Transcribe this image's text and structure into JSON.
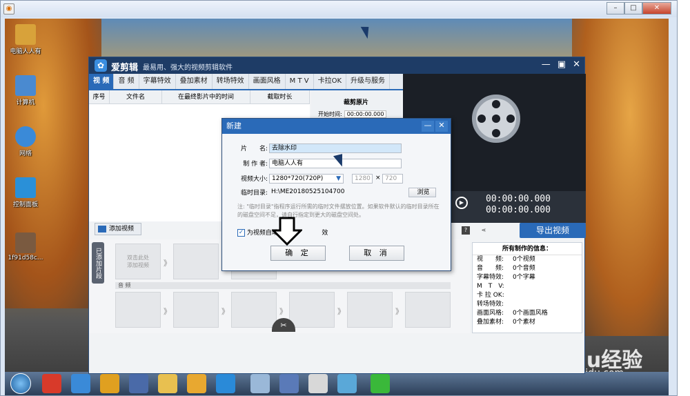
{
  "outer_window": {
    "controls": [
      "–",
      "□",
      "✕"
    ]
  },
  "desktop_icons": [
    {
      "label": "电脑人人有",
      "icon": "folder-icon",
      "color": "#d8a23a"
    },
    {
      "label": "计算机",
      "icon": "computer-icon",
      "color": "#4a8ad0"
    },
    {
      "label": "网络",
      "icon": "network-icon",
      "color": "#3a8ad8"
    },
    {
      "label": "控制面板",
      "icon": "control-panel-icon",
      "color": "#2a90d8"
    },
    {
      "label": "1f91d58c...",
      "icon": "image-file-icon",
      "color": "#7a5a40"
    }
  ],
  "app": {
    "name": "爱剪辑",
    "tagline": "最易用、强大的视频剪辑软件",
    "controls": [
      "—",
      "▣",
      "✕"
    ],
    "tabs": [
      "视 频",
      "音 频",
      "字幕特效",
      "叠加素材",
      "转场特效",
      "画面风格",
      "M T V",
      "卡拉OK",
      "升级与服务"
    ],
    "table_headers": [
      "序号",
      "文件名",
      "在最终影片中的时间",
      "截取时长"
    ],
    "crop": {
      "title": "裁剪原片",
      "start_label": "开始时间:",
      "start_value": "00:00:00.000"
    },
    "time_top": "00:00:00.000",
    "time_bottom": "00:00:00.000",
    "export_label": "导出视频",
    "add_video_label": "添加视频",
    "timeline_label": "已添加片段",
    "first_clip_text": "双击此处\n添加视频",
    "audio_label": "音 频",
    "info": {
      "title": "所有制作的信息：",
      "rows": [
        {
          "k": "视　　频:",
          "v": "0个视频"
        },
        {
          "k": "音　　频:",
          "v": "0个音频"
        },
        {
          "k": "字幕特效:",
          "v": "0个字幕"
        },
        {
          "k": "M　T　V:",
          "v": ""
        },
        {
          "k": "卡 拉 OK:",
          "v": ""
        },
        {
          "k": "转场特效:",
          "v": ""
        },
        {
          "k": "画面风格:",
          "v": "0个画面风格"
        },
        {
          "k": "叠加素材:",
          "v": "0个素材"
        }
      ]
    }
  },
  "dialog": {
    "title": "新建",
    "controls": [
      "—",
      "✕"
    ],
    "fields": {
      "name_label": "片　　名:",
      "name_value": "去除水印",
      "author_label": "制 作 者:",
      "author_value": "电脑人人有",
      "size_label": "视频大小:",
      "size_value": "1280*720(720P)",
      "width_value": "1280",
      "height_value": "720",
      "times": "×",
      "temp_label": "临时目录:",
      "temp_value": "H:\\ME20180525104700",
      "browse_label": "浏览"
    },
    "note": "注: \"临时目录\"指程序运行所需的临时文件摆放位置。如果软件默认的临时目录所在的磁盘空间不足，请自行指定到更大的磁盘空间处。",
    "checkbox_label": "为视频自动...",
    "checkbox_suffix": "效",
    "ok_label": "确 定",
    "cancel_label": "取 消"
  },
  "watermark": {
    "logo": "Baidu经验",
    "url": "jingyan.baidu.com"
  }
}
